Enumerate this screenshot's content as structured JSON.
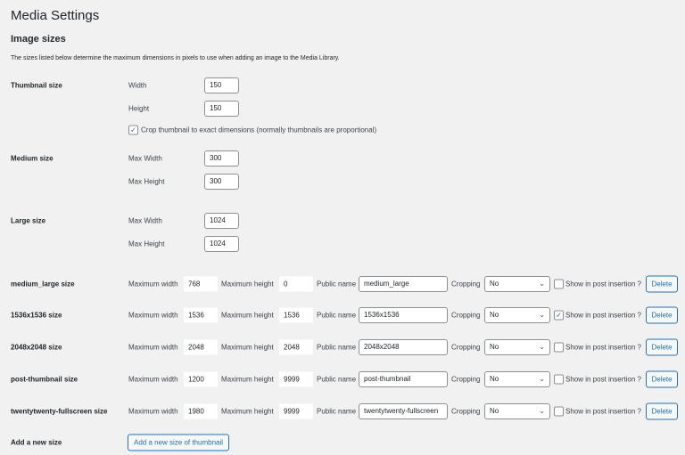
{
  "title": "Media Settings",
  "section": "Image sizes",
  "description": "The sizes listed below determine the maximum dimensions in pixels to use when adding an image to the Media Library.",
  "thumbnail": {
    "label": "Thumbnail size",
    "width_label": "Width",
    "width": "150",
    "height_label": "Height",
    "height": "150",
    "crop_checked": true,
    "crop_label": "Crop thumbnail to exact dimensions (normally thumbnails are proportional)"
  },
  "medium": {
    "label": "Medium size",
    "width_label": "Max Width",
    "width": "300",
    "height_label": "Max Height",
    "height": "300"
  },
  "large": {
    "label": "Large size",
    "width_label": "Max Width",
    "width": "1024",
    "height_label": "Max Height",
    "height": "1024"
  },
  "custom_labels": {
    "max_width": "Maximum width",
    "max_height": "Maximum height",
    "public_name": "Public name",
    "cropping": "Cropping",
    "show": "Show in post insertion ?",
    "delete": "Delete"
  },
  "custom_sizes": [
    {
      "label": "medium_large size",
      "width": "768",
      "height": "0",
      "name": "medium_large",
      "cropping": "No",
      "show": false
    },
    {
      "label": "1536x1536 size",
      "width": "1536",
      "height": "1536",
      "name": "1536x1536",
      "cropping": "No",
      "show": true
    },
    {
      "label": "2048x2048 size",
      "width": "2048",
      "height": "2048",
      "name": "2048x2048",
      "cropping": "No",
      "show": false
    },
    {
      "label": "post-thumbnail size",
      "width": "1200",
      "height": "9999",
      "name": "post-thumbnail",
      "cropping": "No",
      "show": false
    },
    {
      "label": "twentytwenty-fullscreen size",
      "width": "1980",
      "height": "9999",
      "name": "twentytwenty-fullscreen",
      "cropping": "No",
      "show": false
    }
  ],
  "add_new": {
    "label": "Add a new size",
    "button": "Add a new size of thumbnail"
  }
}
